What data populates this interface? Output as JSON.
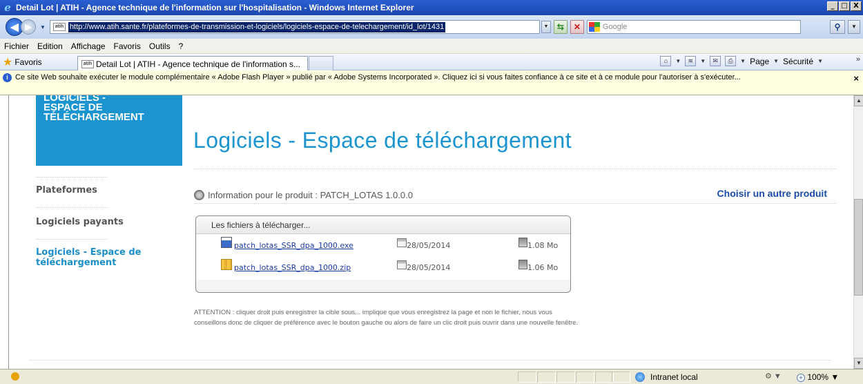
{
  "window": {
    "title": "Detail Lot | ATIH - Agence technique de l'information sur l'hospitalisation - Windows Internet Explorer",
    "min_label": "_",
    "max_label": "□",
    "close_label": "X"
  },
  "address": {
    "favicon_text": "atih",
    "url": "http://www.atih.sante.fr/plateformes-de-transmission-et-logiciels/logiciels-espace-de-telechargement/id_lot/1431",
    "search_placeholder": "Google"
  },
  "menubar": {
    "items": [
      "Fichier",
      "Edition",
      "Affichage",
      "Favoris",
      "Outils",
      "?"
    ]
  },
  "favbar": {
    "favorites_label": "Favoris",
    "tab_title": "Detail Lot | ATIH - Agence technique de l'information s...",
    "page_label": "Page",
    "security_label": "Sécurité"
  },
  "infobar": {
    "message": "Ce site Web souhaite exécuter le module complémentaire « Adobe Flash Player » publié par « Adobe Systems Incorporated ». Cliquez ici si vous faites confiance à ce site et à ce module pour l'autoriser à s'exécuter...",
    "close_label": "×"
  },
  "sidebar": {
    "header_lines": [
      "LOGICIELS -",
      "ESPACE DE",
      "TÉLÉCHARGEMENT"
    ],
    "items": [
      {
        "label": "Plateformes"
      },
      {
        "label": "Logiciels payants"
      },
      {
        "label_lines": [
          "Logiciels - Espace de",
          "téléchargement"
        ]
      }
    ]
  },
  "main": {
    "page_title": "Logiciels - Espace de téléchargement",
    "product_info": "Information pour le produit : PATCH_LOTAS 1.0.0.0",
    "choose_other": "Choisir un autre produit",
    "files_heading": "Les fichiers à télécharger...",
    "files": [
      {
        "name": "patch_lotas_SSR_dpa_1000.exe",
        "date": "28/05/2014",
        "size": "1.08 Mo",
        "icon": "exe-file-icon"
      },
      {
        "name": "patch_lotas_SSR_dpa_1000.zip",
        "date": "28/05/2014",
        "size": "1.06 Mo",
        "icon": "zip-file-icon"
      }
    ],
    "warning": "ATTENTION : cliquer droit puis enregistrer la cible sous... implique que vous enregistrez la page et non le fichier, nous vous conseillons donc de cliquer de préférence avec le bouton gauche ou alors de faire un clic droit puis ouvrir dans une nouvelle fenêtre."
  },
  "status": {
    "zone": "Intranet local",
    "zoom": "100%"
  },
  "colors": {
    "accent": "#1b94d0",
    "link": "#1a4ba8",
    "titlebar": "#1c47b0"
  }
}
